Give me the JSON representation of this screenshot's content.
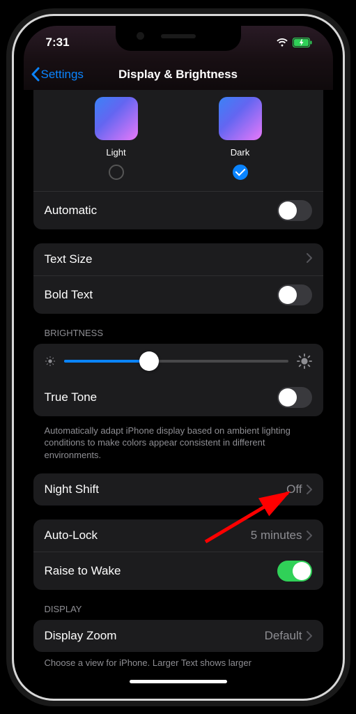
{
  "status": {
    "time": "7:31",
    "wifi_icon": "wifi-icon",
    "battery_icon": "battery-charging-icon"
  },
  "nav": {
    "back_label": "Settings",
    "title": "Display & Brightness"
  },
  "appearance": {
    "light_label": "Light",
    "dark_label": "Dark",
    "selected": "dark",
    "automatic_label": "Automatic",
    "automatic_on": false
  },
  "text": {
    "size_label": "Text Size",
    "bold_label": "Bold Text",
    "bold_on": false
  },
  "brightness": {
    "header": "BRIGHTNESS",
    "slider_value": 0.38,
    "true_tone_label": "True Tone",
    "true_tone_on": false,
    "footer": "Automatically adapt iPhone display based on ambient lighting conditions to make colors appear consistent in different environments."
  },
  "night_shift": {
    "label": "Night Shift",
    "value": "Off"
  },
  "auto_lock": {
    "label": "Auto-Lock",
    "value": "5 minutes",
    "raise_label": "Raise to Wake",
    "raise_on": true
  },
  "display": {
    "header": "DISPLAY",
    "zoom_label": "Display Zoom",
    "zoom_value": "Default",
    "footer_truncated": "Choose a view for iPhone. Larger Text shows larger"
  }
}
